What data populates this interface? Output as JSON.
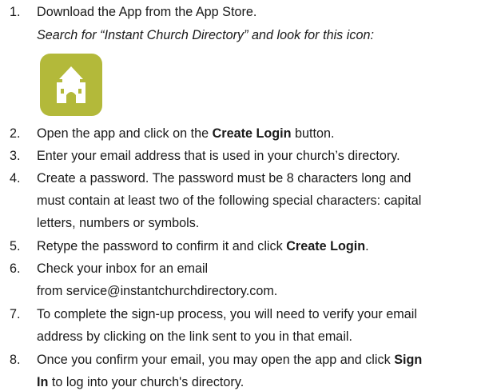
{
  "steps": [
    {
      "num": "1.",
      "lines": [
        "Download the App from the App Store.",
        "Search for “Instant Church Directory” and look for this icon:"
      ]
    },
    {
      "num": "2.",
      "before": "Open the app and click on the ",
      "bold": "Create Login",
      "after": " button."
    },
    {
      "num": "3.",
      "text": "Enter your email address that is used in your church’s directory."
    },
    {
      "num": "4.",
      "lines": [
        "Create a password.  The password must be 8 characters long and",
        "must contain at least two of the following special characters: capital",
        "letters, numbers or symbols."
      ]
    },
    {
      "num": "5.",
      "before": "Retype the password to confirm it and click ",
      "bold": "Create Login",
      "after": "."
    },
    {
      "num": "6.",
      "lines": [
        "Check your inbox for an email",
        "from service@instantchurchdirectory.com."
      ]
    },
    {
      "num": "7.",
      "lines": [
        "To complete the sign-up process, you will need to verify your email",
        "address by clicking on the link sent to you in that email."
      ]
    },
    {
      "num": "8.",
      "line1_before": "Once you confirm your email, you may open the app and click ",
      "line1_bold": "Sign",
      "line2_bold": "In",
      "line2_after": " to log into your church's directory."
    }
  ],
  "app_icon": {
    "name": "church-house-icon",
    "color": "#b3b93a"
  }
}
